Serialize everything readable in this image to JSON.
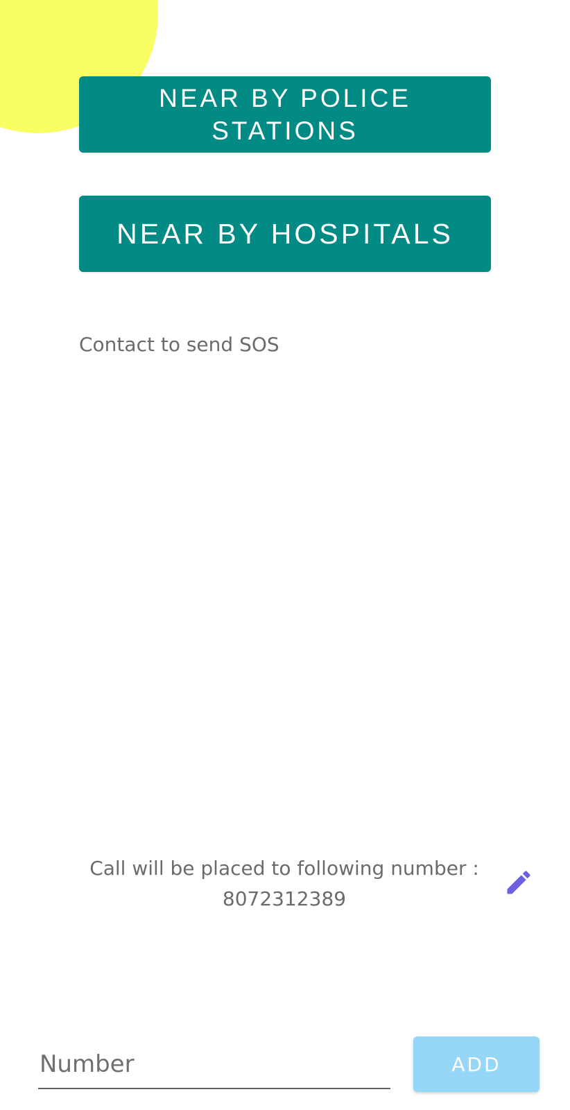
{
  "colors": {
    "accent_teal": "#028a85",
    "decor_yellow": "#f9ff63",
    "edit_icon": "#6e61e0",
    "add_button_disabled": "#96d7f7",
    "secondary_text": "#6b6b6b"
  },
  "actions": {
    "police_label": "NEAR BY POLICE STATIONS",
    "hospitals_label": "NEAR BY HOSPITALS"
  },
  "contacts": {
    "label": "Contact to send SOS"
  },
  "call": {
    "info_text": "Call will be placed to following number :",
    "number": "8072312389",
    "edit_icon": "pencil-icon"
  },
  "add_contact": {
    "number_placeholder": "Number",
    "number_value": "",
    "add_label": "ADD"
  }
}
